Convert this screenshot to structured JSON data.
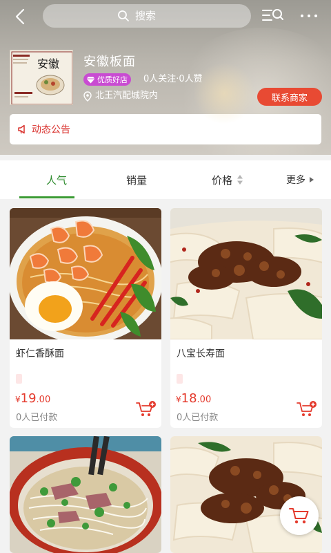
{
  "search": {
    "placeholder": "搜索"
  },
  "store": {
    "name": "安徽板面",
    "badge": "优质好店",
    "stats": "0人关注·0人赞",
    "address": "北王汽配城院内",
    "contact_label": "联系商家",
    "logo_text": "安徽"
  },
  "notice": {
    "label": "动态公告"
  },
  "sort_tabs": {
    "popular": "人气",
    "sales": "销量",
    "price": "价格",
    "more": "更多"
  },
  "products": [
    {
      "name": "虾仁香酥面",
      "currency": "¥",
      "price_int": "19",
      "price_dec": ".00",
      "sold": "0人已付款",
      "image": "shrimp-noodle-bowl"
    },
    {
      "name": "八宝长寿面",
      "currency": "¥",
      "price_int": "18",
      "price_dec": ".00",
      "sold": "0人已付款",
      "image": "meat-sauce-wide-noodle"
    },
    {
      "image": "beef-noodle-soup"
    },
    {
      "image": "meat-sauce-wide-noodle"
    }
  ],
  "colors": {
    "accent_green": "#3b9b34",
    "price_red": "#e43a2d",
    "contact_red": "#e84a33",
    "badge_purple": "#c94bd2"
  }
}
